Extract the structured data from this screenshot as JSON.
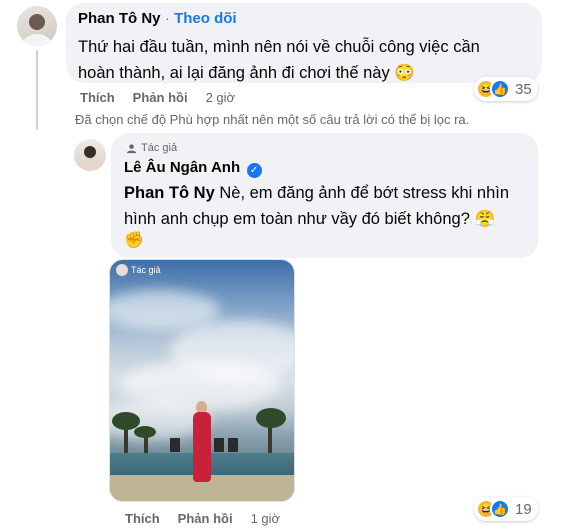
{
  "comment1": {
    "author": "Phan Tô Ny",
    "separator": "·",
    "follow_label": "Theo dõi",
    "text_line1": "Thứ hai đầu tuần, mình nên nói về chuỗi công việc cần",
    "text_line2": "hoàn thành, ai lại đăng ảnh đi chơi thế này 😳",
    "like_label": "Thích",
    "reply_label": "Phản hồi",
    "time": "2 giờ",
    "reaction_count": "35",
    "reaction_icons": [
      "haha-icon",
      "like-icon"
    ]
  },
  "filter_note": "Đã chọn chế độ Phù hợp nhất nên một số câu trả lời có thể bị lọc ra.",
  "reply1": {
    "badge": "Tác giả",
    "author": "Lê Âu Ngân Anh",
    "mention": "Phan Tô Ny",
    "text_line1": " Nè, em đăng ảnh để bớt stress khi nhìn",
    "text_line2": "hình anh chụp em toàn như vầy đó biết không? 😤",
    "emoji": "✊",
    "photo_tag": "Tác giả",
    "like_label": "Thích",
    "reply_label": "Phản hồi",
    "time": "1 giờ",
    "reaction_count": "19",
    "reaction_icons": [
      "haha-icon",
      "like-icon"
    ]
  },
  "colors": {
    "accent": "#1877f2",
    "bubble": "#f0f2f5",
    "muted": "#65676b"
  }
}
